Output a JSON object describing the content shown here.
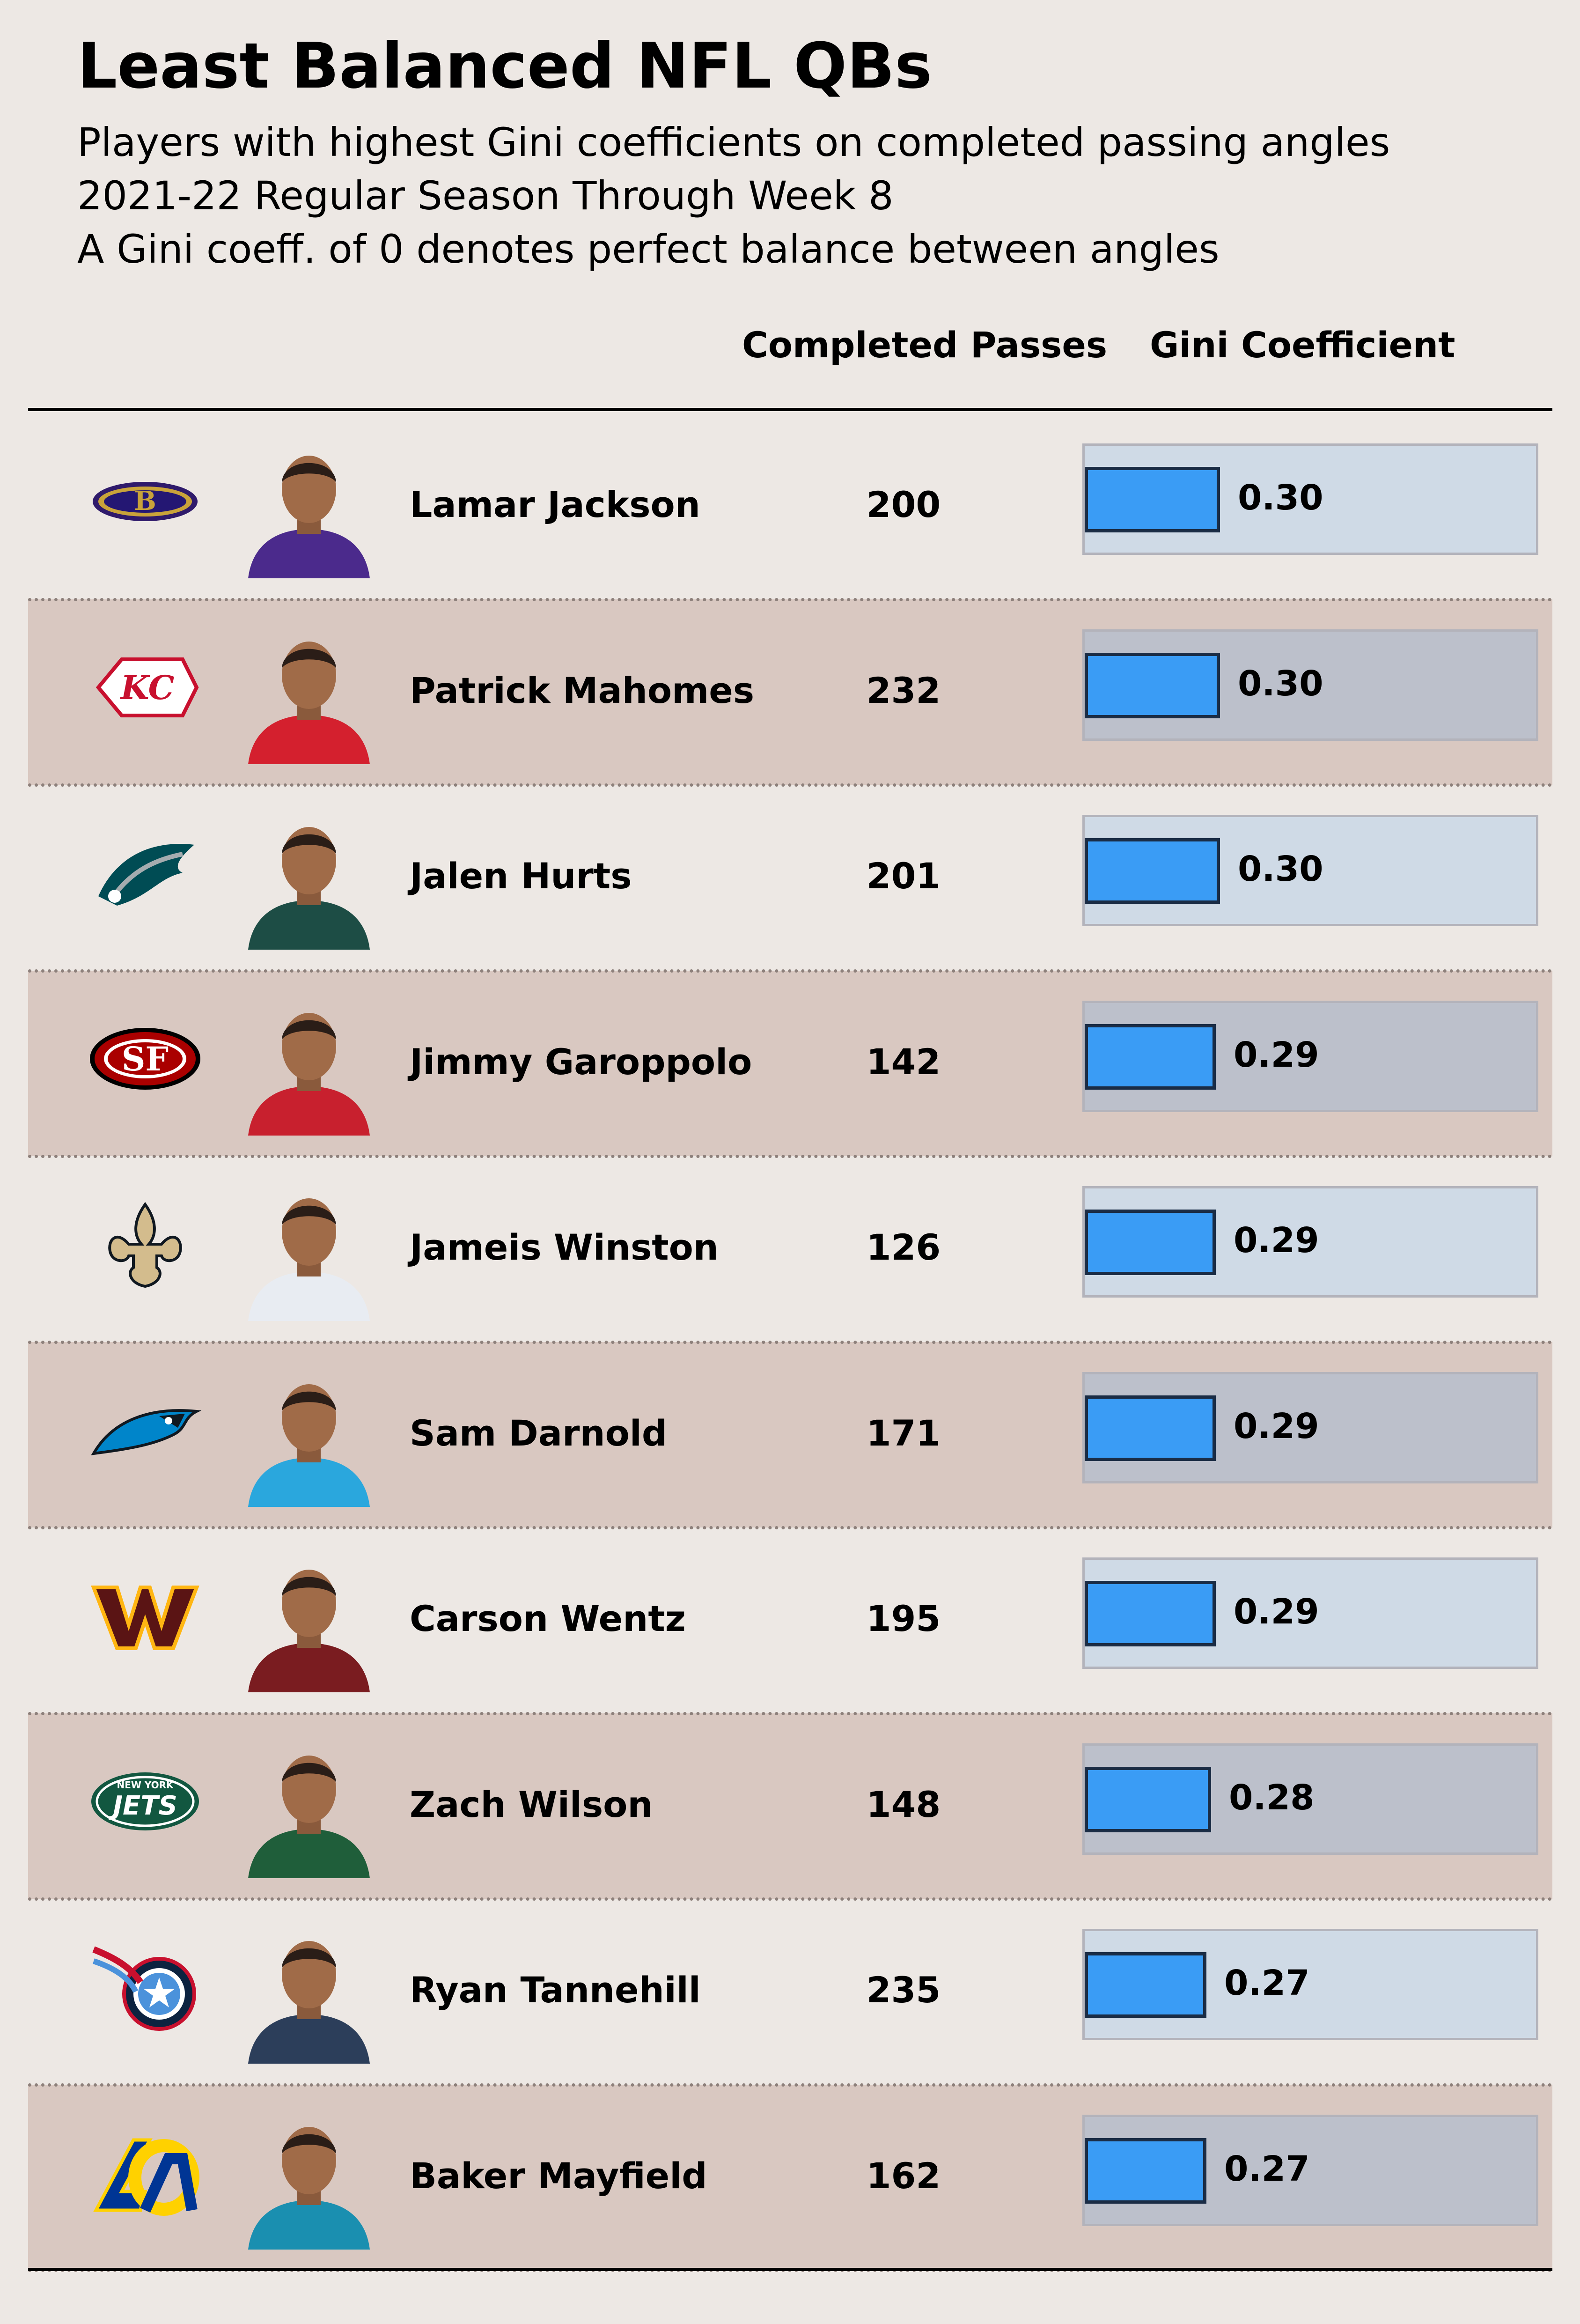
{
  "title": "Least Balanced NFL QBs",
  "subtitle_lines": [
    "Players with highest Gini coefficients on completed passing angles",
    "2021-22 Regular Season Through Week 8",
    "A Gini coeff. of 0 denotes perfect balance between angles"
  ],
  "columns": {
    "passes": "Completed Passes",
    "gini": "Gini Coefficient"
  },
  "colors": {
    "background": "#ede8e4",
    "row_shaded": "#d9c8c1",
    "bar_fill": "#3a9cf5",
    "bar_track": "#cfdae6",
    "bar_track_shaded": "#bcc0cb"
  },
  "chart_data": {
    "type": "table",
    "gini_max": 1.0,
    "rows": [
      {
        "team_logo": "ravens-logo",
        "player": "Lamar Jackson",
        "completed_passes": 200,
        "gini": 0.3,
        "gini_label": "0.30",
        "jersey_color": "#4b2a8c"
      },
      {
        "team_logo": "chiefs-logo",
        "player": "Patrick Mahomes",
        "completed_passes": 232,
        "gini": 0.3,
        "gini_label": "0.30",
        "jersey_color": "#d4202e"
      },
      {
        "team_logo": "eagles-logo",
        "player": "Jalen Hurts",
        "completed_passes": 201,
        "gini": 0.3,
        "gini_label": "0.30",
        "jersey_color": "#1d4d45"
      },
      {
        "team_logo": "49ers-logo",
        "player": "Jimmy Garoppolo",
        "completed_passes": 142,
        "gini": 0.29,
        "gini_label": "0.29",
        "jersey_color": "#c8202e"
      },
      {
        "team_logo": "saints-logo",
        "player": "Jameis Winston",
        "completed_passes": 126,
        "gini": 0.29,
        "gini_label": "0.29",
        "jersey_color": "#e8ecf2"
      },
      {
        "team_logo": "panthers-logo",
        "player": "Sam Darnold",
        "completed_passes": 171,
        "gini": 0.29,
        "gini_label": "0.29",
        "jersey_color": "#2aa7dd"
      },
      {
        "team_logo": "washington-logo",
        "player": "Carson Wentz",
        "completed_passes": 195,
        "gini": 0.29,
        "gini_label": "0.29",
        "jersey_color": "#7a1c20"
      },
      {
        "team_logo": "jets-logo",
        "player": "Zach Wilson",
        "completed_passes": 148,
        "gini": 0.28,
        "gini_label": "0.28",
        "jersey_color": "#1f5e3a"
      },
      {
        "team_logo": "titans-logo",
        "player": "Ryan Tannehill",
        "completed_passes": 235,
        "gini": 0.27,
        "gini_label": "0.27",
        "jersey_color": "#2c3e5a"
      },
      {
        "team_logo": "rams-logo",
        "player": "Baker Mayfield",
        "completed_passes": 162,
        "gini": 0.27,
        "gini_label": "0.27",
        "jersey_color": "#1a8fb0"
      }
    ]
  }
}
